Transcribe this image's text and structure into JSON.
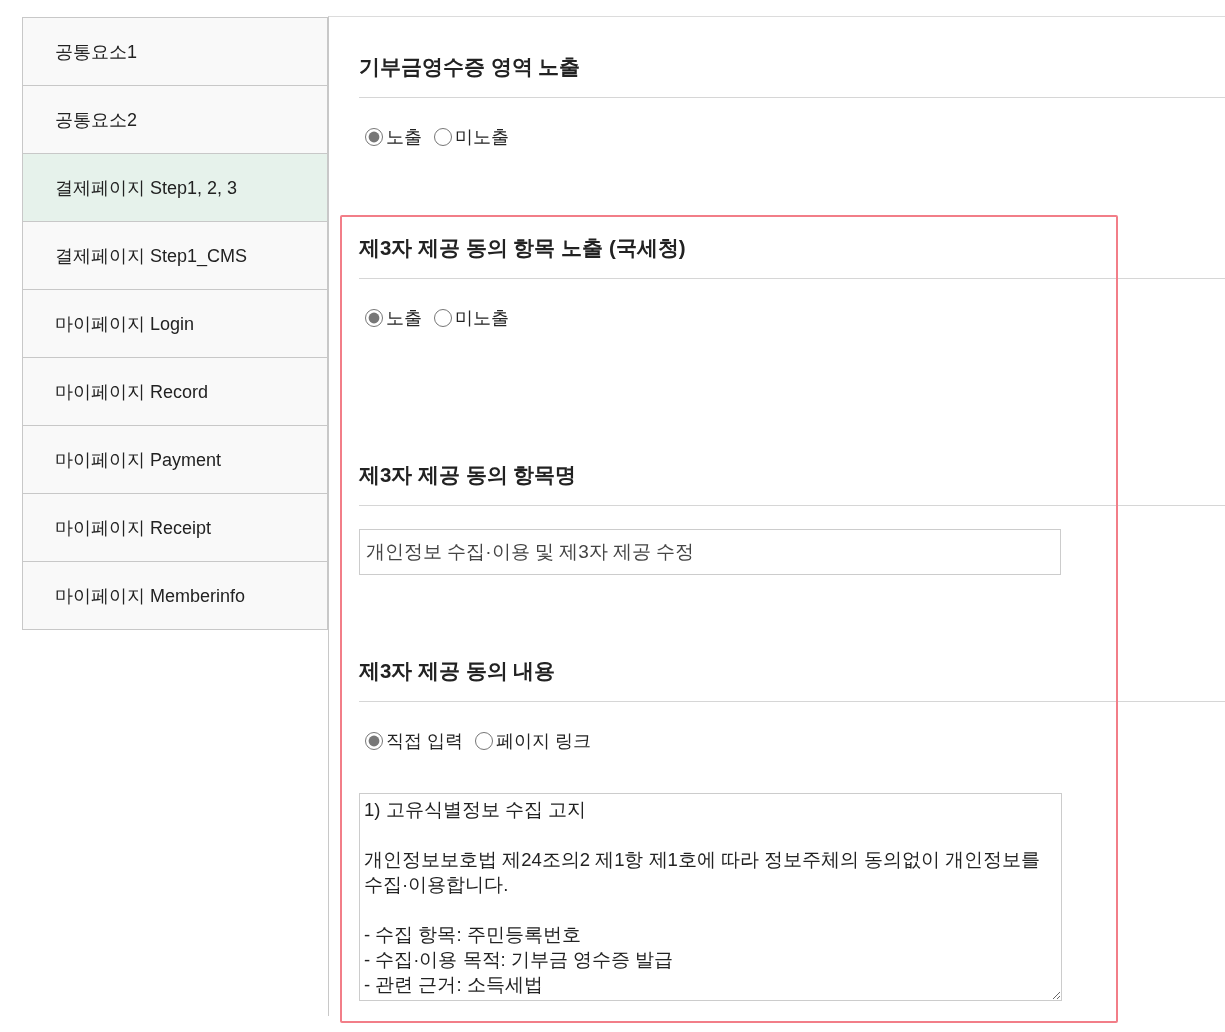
{
  "sidebar": {
    "items": [
      {
        "label": "공통요소1",
        "selected": false
      },
      {
        "label": "공통요소2",
        "selected": false
      },
      {
        "label": "결제페이지 Step1, 2, 3",
        "selected": true
      },
      {
        "label": "결제페이지 Step1_CMS",
        "selected": false
      },
      {
        "label": "마이페이지 Login",
        "selected": false
      },
      {
        "label": "마이페이지 Record",
        "selected": false
      },
      {
        "label": "마이페이지 Payment",
        "selected": false
      },
      {
        "label": "마이페이지 Receipt",
        "selected": false
      },
      {
        "label": "마이페이지 Memberinfo",
        "selected": false
      }
    ]
  },
  "sections": [
    {
      "title": "기부금영수증 영역 노출",
      "highlighted": false,
      "fields": [
        {
          "kind": "radio",
          "options": [
            {
              "label": "노출",
              "selected": true
            },
            {
              "label": "미노출",
              "selected": false
            }
          ]
        }
      ]
    },
    {
      "title": "제3자 제공 동의 항목 노출 (국세청)",
      "highlighted": true,
      "fields": [
        {
          "kind": "radio",
          "options": [
            {
              "label": "노출",
              "selected": true
            },
            {
              "label": "미노출",
              "selected": false
            }
          ]
        }
      ]
    },
    {
      "title": "제3자 제공 동의 항목명",
      "highlighted": true,
      "fields": [
        {
          "kind": "text",
          "value": "개인정보 수집·이용 및 제3자 제공 수정"
        }
      ]
    },
    {
      "title": "제3자 제공 동의 내용",
      "highlighted": true,
      "fields": [
        {
          "kind": "radio",
          "options": [
            {
              "label": "직접 입력",
              "selected": true
            },
            {
              "label": "페이지 링크",
              "selected": false
            }
          ]
        },
        {
          "kind": "textarea",
          "value": "1) 고유식별정보 수집 고지\n\n개인정보보호법 제24조의2 제1항 제1호에 따라 정보주체의 동의없이 개인정보를 수집·이용합니다.\n\n- 수집 항목: 주민등록번호\n- 수집·이용 목적: 기부금 영수증 발급\n- 관련 근거: 소득세법"
        }
      ]
    }
  ]
}
